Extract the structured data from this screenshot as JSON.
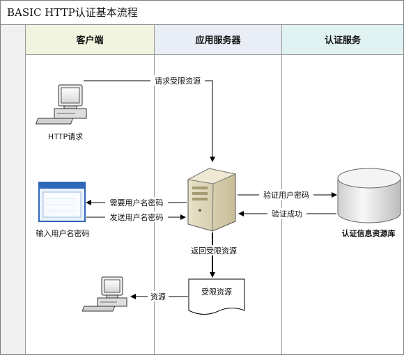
{
  "title": "BASIC HTTP认证基本流程",
  "lanes": [
    {
      "label": "客户端",
      "color": "#f1f4df"
    },
    {
      "label": "应用服务器",
      "color": "#e9eef6"
    },
    {
      "label": "认证服务",
      "color": "#e1f2f2"
    }
  ],
  "edges": {
    "request_resource": "请求受限资源",
    "need_credentials": "需要用户名密码",
    "send_credentials": "发送用户名密码",
    "verify_credentials": "验证用户密码",
    "verify_success": "验证成功",
    "return_resource": "返回受限资源",
    "resource": "资源"
  },
  "nodes": {
    "http_request": "HTTP请求",
    "input_credentials": "输入用户名密码",
    "auth_db": "认证信息资源库",
    "restricted_resource": "受限资源"
  },
  "icons": [
    "computer-icon",
    "login-window-icon",
    "server-icon",
    "database-icon",
    "document-icon",
    "computer-icon"
  ]
}
